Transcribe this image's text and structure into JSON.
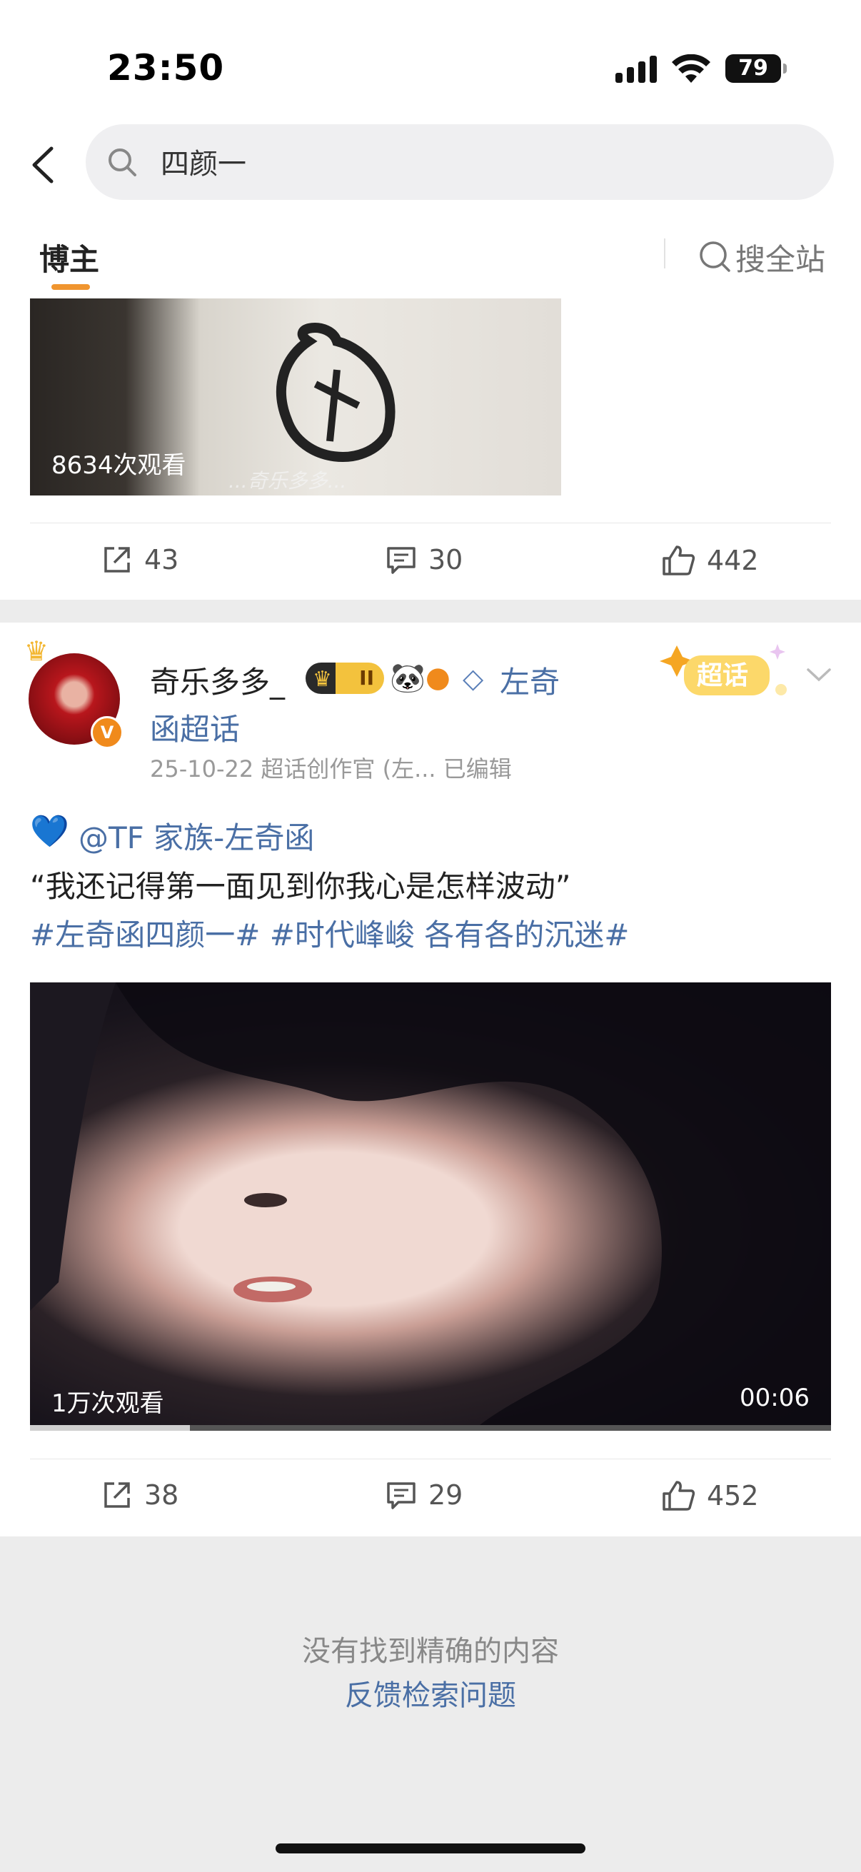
{
  "status_bar": {
    "time": "23:50",
    "battery": "79"
  },
  "search": {
    "query": "四颜一"
  },
  "tabs": {
    "active": "博主",
    "site_search": "搜全站"
  },
  "post1": {
    "views": "8634次观看",
    "watermark": "...奇乐多多...",
    "actions": {
      "share": "43",
      "comment": "30",
      "like": "442"
    }
  },
  "post2": {
    "username": "奇乐多多_",
    "topic_line1": "左奇",
    "topic_line2": "函超话",
    "meta": "25-10-22  超话创作官 (左...  已编辑",
    "chaohua_badge": "超话",
    "body": {
      "heart": "💙",
      "mention": "@TF 家族-左奇函",
      "quote": "“我还记得第一面见到你我心是怎样波动”",
      "hashtags": "#左奇函四颜一# #时代峰峻 各有各的沉迷#"
    },
    "video": {
      "views": "1万次观看",
      "duration": "00:06",
      "progress": 0.2
    },
    "actions": {
      "share": "38",
      "comment": "29",
      "like": "452"
    }
  },
  "footer": {
    "no_result": "没有找到精确的内容",
    "feedback": "反馈检索问题"
  },
  "colors": {
    "accent": "#f0952f",
    "link": "#4a6fa5"
  }
}
